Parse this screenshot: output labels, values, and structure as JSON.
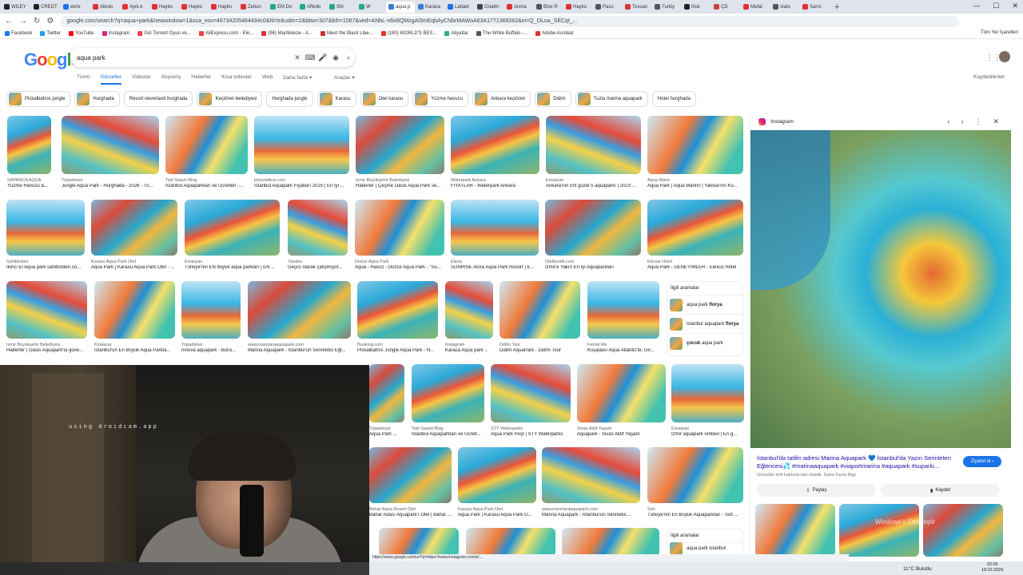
{
  "browser": {
    "tabs": [
      "WILEY",
      "CREDT",
      "ekrix",
      "Alkolo",
      "Ayık-k",
      "Hayko",
      "Hayko",
      "Hayko",
      "Zeitun",
      "EM Do",
      "Affedo",
      "Shi",
      "W",
      "aqua p",
      "Karaca",
      "Lattakt",
      "Gnattn",
      "Anma",
      "Bize R",
      "Hayko",
      "Pazo",
      "Toscan",
      "Turkiy",
      "frisk",
      "ÇD",
      "Mefal",
      "stato",
      "Sarro"
    ],
    "active_tab": "aqua p",
    "new_tab": "+",
    "url": "google.com/search?q=aqua+park&newwindow=1&sca_esv=46734205464434c0&hl=tr&udm=2&bbw=307&bih=1567&ved=ANbL-n6o6QMzgAl3mEqbAyCNbrMAWoA63A1771369282&ei=Q_OLoa_SECqt_..."
  },
  "bookmarks": [
    "Facebook",
    "Twitter",
    "YouTube",
    "Instagram",
    "Gül Torrent Oyun ve...",
    "AliExpress.com - Ele...",
    "(96) Marifetecle - A...",
    "Meet the Black Libe...",
    "(190) WORLD'S BES...",
    "Aliyatlar",
    "The White Buffalo -...",
    "Adobe Acrobat"
  ],
  "all_bookmarks": "Tüm Yer İşaretleri",
  "google": {
    "logo": [
      "G",
      "o",
      "o",
      "g",
      "l",
      "e"
    ],
    "query": "aqua park",
    "tabs": [
      "Tümü",
      "Görseller",
      "Videolar",
      "Alışveriş",
      "Haberler",
      "Kısa videolar",
      "Web",
      "Daha fazla ▾"
    ],
    "active_tab": "Görseller",
    "tools": "Araçlar ▾",
    "saved": "Kaydedilenler"
  },
  "chips": [
    "Pickalbatros jungle",
    "Hurghada",
    "Resort neverland hurghada",
    "Keçiören belediyesi",
    "Hurghada jungle",
    "Karasu",
    "Otel karasu",
    "Yüzme havuzu",
    "Ankara keçiören",
    "Didim",
    "Tuzla marina aquapark",
    "Hotel hurghada"
  ],
  "row1": [
    {
      "src": "SAPANCA AQUA",
      "title": "Yüzme Havuzu &..."
    },
    {
      "src": "Tripadvisor",
      "title": "Jungle Aqua Park - Hurghada - 2026 - Tri..."
    },
    {
      "src": "Tatil Sepeti Blog",
      "title": "İstanbul Aquaparkları ve Ücretleri -..."
    },
    {
      "src": "jetzprisfiesi.com",
      "title": "İstanbul Aquapark Fiyatları 2025 | En İyi ..."
    },
    {
      "src": "İzmir Büyükşehir Belediyesi",
      "title": "Haberler | Çeşme Oasis Aqua Park se..."
    },
    {
      "src": "Waterpark Ankara",
      "title": "FİYATLAR - Waterpark Ankara"
    },
    {
      "src": "Emarpan",
      "title": "Ankara'nın EN güzel 5 aquaparkı | 2023 ..."
    },
    {
      "src": "Aqua Marin",
      "title": "Aqua Park | Aqua Marinn | Yalova'nın Ko..."
    }
  ],
  "row2": [
    {
      "src": "Sahibinden",
      "title": "İkinci El Aqua park sahibinden.co..."
    },
    {
      "src": "Karasu Aqua Park Otel",
      "title": "Aqua Park | Karasu Aqua Park Otel - ..."
    },
    {
      "src": "Emarpan",
      "title": "Türkiye'nin EN büyük aqua parkları | EN ..."
    },
    {
      "src": "Yandex",
      "title": "Geçici olarak çalışmıyor..."
    },
    {
      "src": "Düzce Aqua Park",
      "title": "Aqua - Havuz - Düzce Aqua Park - \"Su..."
    },
    {
      "src": "Elexa",
      "title": "SUNRISE Alora Aqua Park Resort | E..."
    },
    {
      "src": "Otelbestik.com",
      "title": "İzmir'e Yakın En İyi Aquaparkları"
    },
    {
      "src": "Elexus Hotel",
      "title": "Aqua Park - DENEYİMLER - Elexus Hotel"
    }
  ],
  "row3": [
    {
      "src": "İzmir Büyükşehir Belediyesi",
      "title": "Haberler | Oasis Aquapark'ta güve..."
    },
    {
      "src": "Kiralacar",
      "title": "İstanbul'un En Büyük Aqua Parkla..."
    },
    {
      "src": "Tripadvisor",
      "title": "ninova aquapark - Bursi..."
    },
    {
      "src": "www.marmaraaquapark.com",
      "title": "Marina Aquapark - İstanbul'un Serinletici Eğl..."
    },
    {
      "src": "Booking.com",
      "title": "Pickalbatros Jungle Aqua Park - N..."
    },
    {
      "src": "Instagram",
      "title": "Karaca Aqua park ..."
    },
    {
      "src": "Didim Tour",
      "title": "Didim AquaPark - Didim Tour"
    },
    {
      "src": "Femal Me",
      "title": "Kuşadası Aqua Atlantis'te; Gir..."
    }
  ],
  "row4": [
    {
      "src": "Tripadvisor",
      "title": "Aqua Park ..."
    },
    {
      "src": "Tatil Sepeti Blog",
      "title": "İstanbul Aquaparkları ve Ücretl..."
    },
    {
      "src": "STY Waterparks",
      "title": "Aqua Park Peşt | STY Waterparks"
    },
    {
      "src": "Sivas Aktif Yaşam",
      "title": "Aquapark - Sivas Aktif Yaşam"
    },
    {
      "src": "Emarpan",
      "title": "İzmir aquapark rehberi | En g..."
    }
  ],
  "row5": [
    {
      "src": "Bahar Aqua Resort Otel",
      "title": "Bahar Adası Aquapark'ı Otel | Bahar ..."
    },
    {
      "src": "Karasu Aqua Park Otel",
      "title": "Aqua Park | Karasu Aqua Park O..."
    },
    {
      "src": "www.marmaraaquapark.com",
      "title": "Marina Aquapark - İstanbul'un Serinletic..."
    },
    {
      "src": "Sixt",
      "title": "Türkiye'nin En Büyük Aquaparkları - Sixt ..."
    }
  ],
  "related": {
    "heading": "İlgili aramalar",
    "items": [
      {
        "pre": "aqua park ",
        "bold": "florya"
      },
      {
        "pre": "istanbul aquapark ",
        "bold": "florya"
      },
      {
        "pre": "",
        "bold": "çocuk",
        "post": " aqua park"
      }
    ]
  },
  "related2": {
    "heading": "İlgili aramalar",
    "item": "aqua park istanbul"
  },
  "panel": {
    "source": "Instagram",
    "title": "İstanbul'da tatilin adresi Marina Aquapark 💙 İstanbul'da Yazın Serinleten Eğlencesi💦 #marinaaquapark #viaportmarina #aquapark #suparki...",
    "visit": "Ziyaret et ›",
    "note": "Görseller telif hakkına tabi olabilir. Daha Fazla Bilgi",
    "share": "Paylaş",
    "save": "Kaydet"
  },
  "webcam": {
    "watermark": "using droidcam.app"
  },
  "statusbar": "https://www.google.com/url?q=https://www.instagram.com/p/...",
  "taskbar": {
    "weather": "11°C Bulutlu",
    "time": "02:06",
    "date": "18.02.2026",
    "windows_watermark": "Windows'u Etkinleştir"
  }
}
